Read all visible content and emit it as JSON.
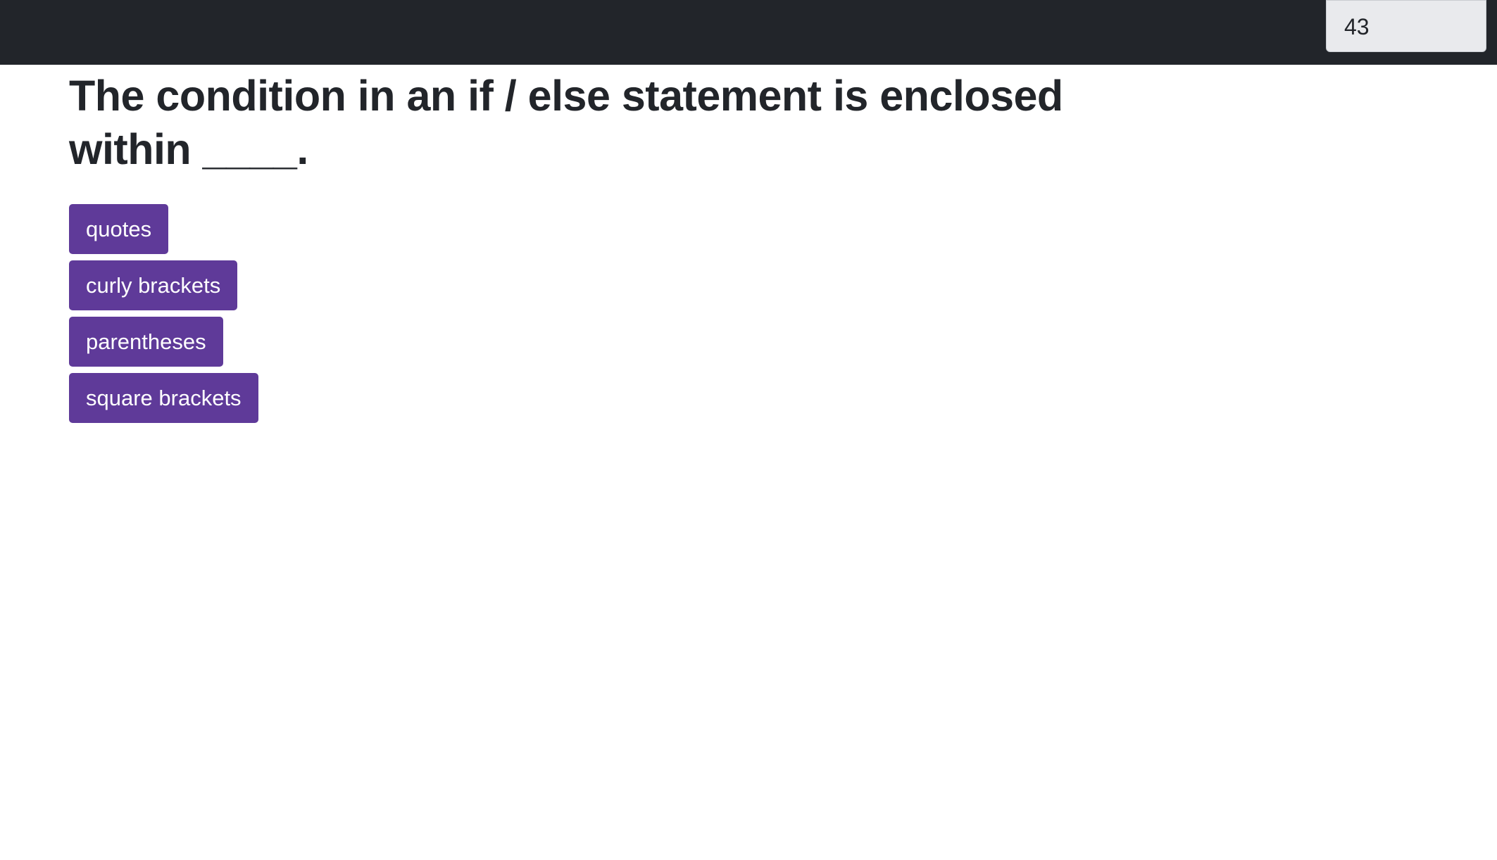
{
  "header": {
    "timer_value": "43"
  },
  "quiz": {
    "question": "The condition in an if / else statement is enclosed within ____.",
    "answers": [
      {
        "label": "quotes"
      },
      {
        "label": "curly brackets"
      },
      {
        "label": "parentheses"
      },
      {
        "label": "square brackets"
      }
    ]
  },
  "colors": {
    "topbar": "#22252a",
    "timer_background": "#e9eaed",
    "answer_button": "#5f3a99",
    "text": "#22252a"
  }
}
